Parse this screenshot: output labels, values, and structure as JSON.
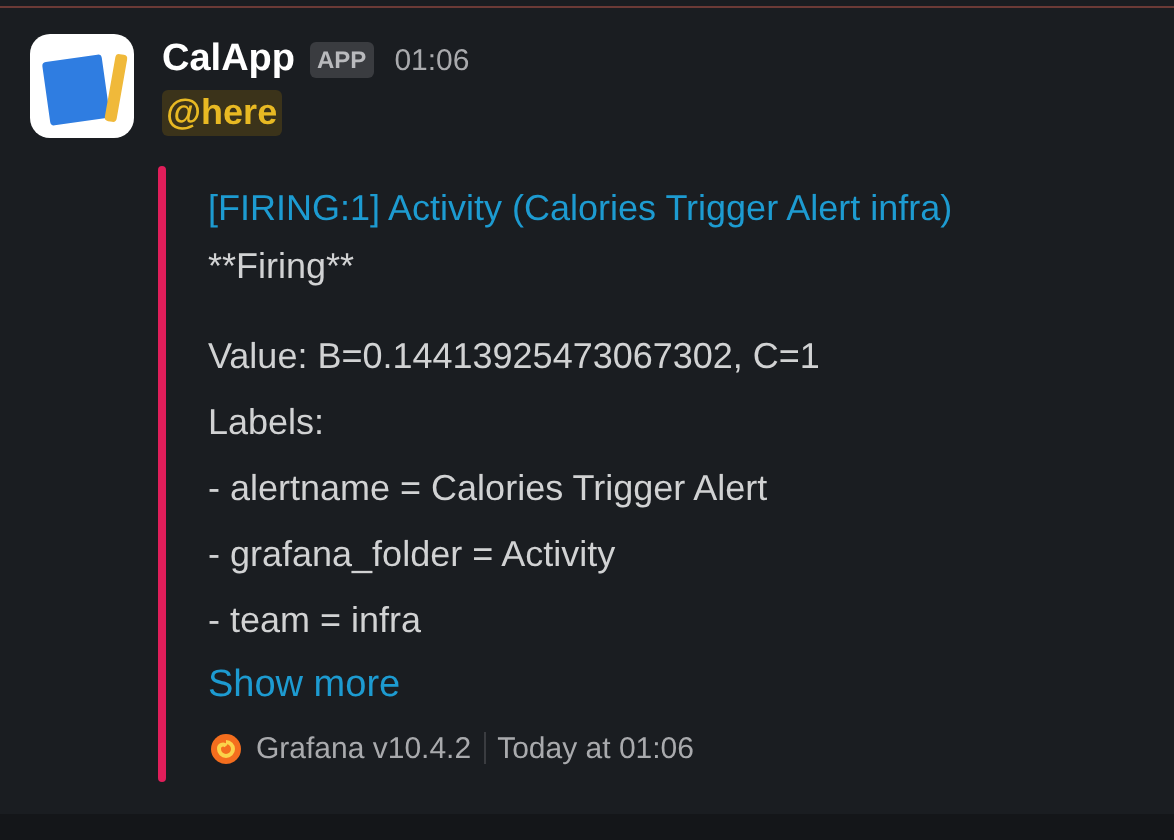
{
  "message": {
    "sender": "CalApp",
    "badge": "APP",
    "time": "01:06",
    "mention": "@here"
  },
  "attachment": {
    "color": "#e01e5a",
    "title": "[FIRING:1] Activity (Calories Trigger Alert infra)",
    "status": "**Firing**",
    "lines": [
      "Value: B=0.14413925473067302, C=1",
      "Labels:",
      "- alertname = Calories Trigger Alert",
      "- grafana_folder = Activity",
      "- team = infra"
    ],
    "show_more": "Show more",
    "footer": "Grafana v10.4.2",
    "footer_time": "Today at 01:06"
  }
}
